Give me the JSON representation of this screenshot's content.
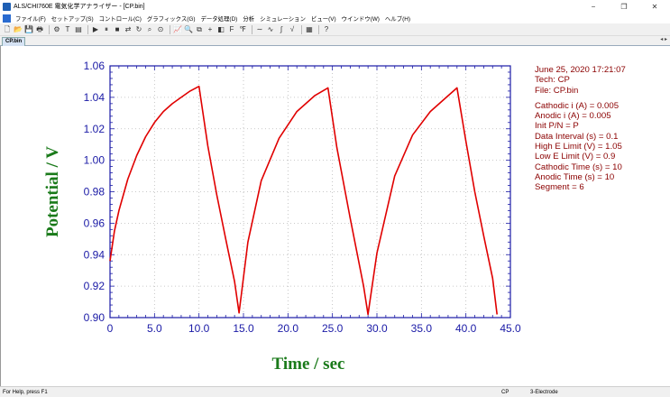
{
  "window": {
    "title": "ALS/CHI760E 電気化学アナライザー - [CP.bin]",
    "controls": [
      "−",
      "❐",
      "✕"
    ]
  },
  "menu": [
    "ファイル(F)",
    "セットアップ(S)",
    "コントロール(C)",
    "グラフィックス(G)",
    "データ処理(D)",
    "分析",
    "シミュレーション",
    "ビュー(V)",
    "ウインドウ(W)",
    "ヘルプ(H)"
  ],
  "toolbar": {
    "groups": [
      [
        "new-icon",
        "open-icon",
        "save-icon",
        "print-icon"
      ],
      [
        "technique-icon",
        "text-icon",
        "parameters-icon"
      ],
      [
        "run-icon",
        "pause-icon",
        "stop-icon",
        "reverse-icon",
        "repeat-icon",
        "zoom-icon",
        "cell-icon"
      ],
      [
        "graph-icon",
        "magnify-icon",
        "overlay-icon",
        "add-icon",
        "color-icon",
        "font-icon",
        "format-icon"
      ],
      [
        "smooth-icon",
        "derivative-icon",
        "integrate-icon",
        "math-icon"
      ],
      [
        "grid-icon"
      ],
      [
        "help-icon"
      ]
    ],
    "glyphs": {
      "new-icon": "🗋",
      "open-icon": "📂",
      "save-icon": "💾",
      "print-icon": "🖶",
      "technique-icon": "⚙",
      "text-icon": "T",
      "parameters-icon": "▤",
      "run-icon": "▶",
      "pause-icon": "⏸",
      "stop-icon": "■",
      "reverse-icon": "⇄",
      "repeat-icon": "↻",
      "zoom-icon": "⌕",
      "cell-icon": "⊙",
      "graph-icon": "📈",
      "magnify-icon": "🔍",
      "overlay-icon": "⧉",
      "add-icon": "+",
      "color-icon": "◧",
      "font-icon": "F",
      "format-icon": "℉",
      "smooth-icon": "∼",
      "derivative-icon": "∿",
      "integrate-icon": "∫",
      "math-icon": "√",
      "grid-icon": "▦",
      "help-icon": "?"
    }
  },
  "document": {
    "tab": "CP.bin",
    "nav": "◂ ▸"
  },
  "parameters": {
    "datetime": "June 25, 2020   17:21:07",
    "tech": "Tech: CP",
    "file": "File: CP.bin",
    "lines": [
      "Cathodic i (A) = 0.005",
      "Anodic i (A) = 0.005",
      "Init P/N = P",
      "Data Interval (s) = 0.1",
      "High E Limit (V) = 1.05",
      "Low E Limit (V) = 0.9",
      "Cathodic Time (s) = 10",
      "Anodic Time (s) = 10",
      "Segment = 6"
    ]
  },
  "status": {
    "help": "For Help, press F1",
    "tech": "CP",
    "electrode": "3-Electrode"
  },
  "colors": {
    "axis": "#1a1aa6",
    "trace": "#e00000",
    "label": "#1a7a1a",
    "params": "#8b0000",
    "grid": "#b8b8b8"
  },
  "chart_data": {
    "type": "line",
    "xlabel": "Time / sec",
    "ylabel": "Potential / V",
    "xlim": [
      0,
      45
    ],
    "ylim": [
      0.9,
      1.06
    ],
    "xticks": [
      "0",
      "5.0",
      "10.0",
      "15.0",
      "20.0",
      "25.0",
      "30.0",
      "35.0",
      "40.0",
      "45.0"
    ],
    "yticks": [
      "0.90",
      "0.92",
      "0.94",
      "0.96",
      "0.98",
      "1.00",
      "1.02",
      "1.04",
      "1.06"
    ],
    "grid": true,
    "series": [
      {
        "x": [
          0,
          0.5,
          1,
          2,
          3,
          4,
          5,
          6,
          7,
          8,
          9,
          10,
          11,
          12,
          13,
          14,
          14.5,
          15.5,
          17,
          19,
          21,
          23,
          24.5,
          25.5,
          27,
          28.5,
          29,
          30,
          32,
          34,
          36,
          38,
          39,
          40,
          41,
          42,
          43,
          43.5
        ],
        "y": [
          0.936,
          0.955,
          0.968,
          0.988,
          1.003,
          1.015,
          1.024,
          1.031,
          1.036,
          1.04,
          1.044,
          1.047,
          1.009,
          0.978,
          0.95,
          0.923,
          0.903,
          0.948,
          0.987,
          1.014,
          1.031,
          1.041,
          1.046,
          1.008,
          0.963,
          0.92,
          0.902,
          0.941,
          0.99,
          1.016,
          1.031,
          1.041,
          1.046,
          1.012,
          0.98,
          0.952,
          0.925,
          0.902
        ]
      }
    ]
  }
}
